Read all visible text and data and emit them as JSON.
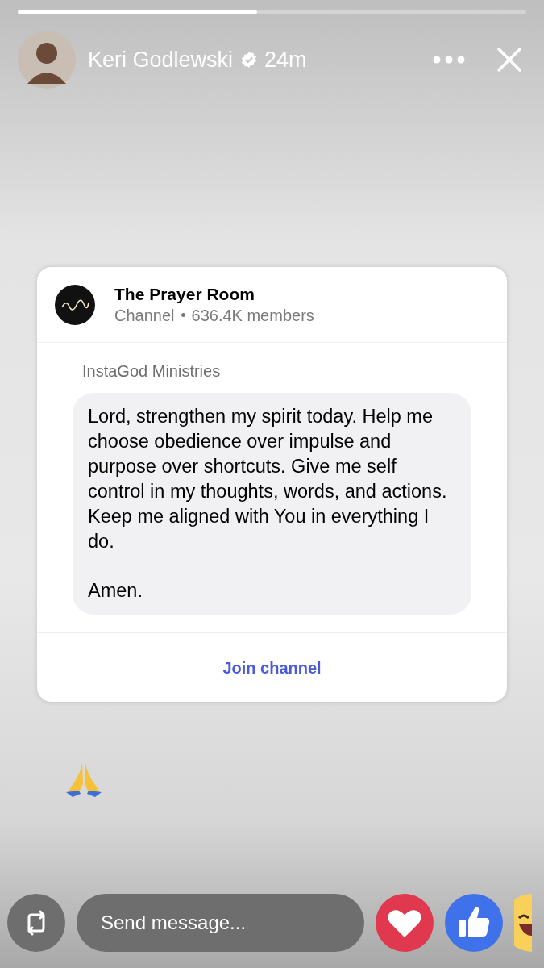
{
  "story_progress": {
    "level": 0.47
  },
  "header": {
    "author": "Keri Godlewski",
    "verified": true,
    "time": "24m"
  },
  "channel_card": {
    "name": "The Prayer Room",
    "type": "Channel",
    "members": "636.4K members",
    "sender": "InstaGod Ministries",
    "message": [
      "Lord, strengthen my spirit today. Help me choose obedience over impulse and purpose over shortcuts. Give me self control in my thoughts, words, and actions. Keep me aligned with You in everything I do.",
      "Amen."
    ],
    "action": "Join channel"
  },
  "footer": {
    "placeholder": "Send message..."
  }
}
